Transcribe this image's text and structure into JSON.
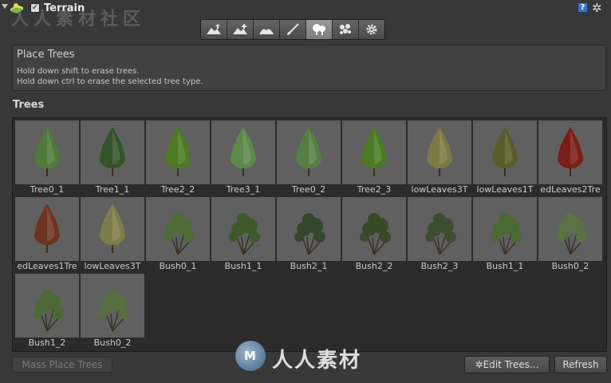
{
  "component": {
    "title": "Terrain",
    "enabled_mark": "✓",
    "help_glyph": "?",
    "menu_glyph": "✲"
  },
  "watermark_top": "人人素材社区",
  "toolbar": {
    "tools": [
      {
        "name": "raise-lower-terrain",
        "icon": "mountain-arrow-icon"
      },
      {
        "name": "paint-height",
        "icon": "mountain-plus-icon"
      },
      {
        "name": "smooth-height",
        "icon": "mountain-smooth-icon"
      },
      {
        "name": "paint-texture",
        "icon": "brush-icon"
      },
      {
        "name": "place-trees",
        "icon": "trees-icon",
        "active": true
      },
      {
        "name": "paint-details",
        "icon": "flowers-icon"
      },
      {
        "name": "terrain-settings",
        "icon": "gear-icon"
      }
    ]
  },
  "info": {
    "title": "Place Trees",
    "line1": "Hold down shift to erase trees.",
    "line2": "Hold down ctrl to erase the selected tree type."
  },
  "trees_section": {
    "label": "Trees"
  },
  "trees": [
    {
      "label": "Tree0_1",
      "kind": "conifer",
      "color": "#4f7a3a"
    },
    {
      "label": "Tree1_1",
      "kind": "conifer",
      "color": "#34532a"
    },
    {
      "label": "Tree2_2",
      "kind": "conifer",
      "color": "#4d7a22"
    },
    {
      "label": "Tree3_1",
      "kind": "conifer",
      "color": "#5c8a4a"
    },
    {
      "label": "Tree0_2",
      "kind": "conifer",
      "color": "#557f42"
    },
    {
      "label": "Tree2_3",
      "kind": "conifer",
      "color": "#4b7a24"
    },
    {
      "label": "lowLeaves3T",
      "kind": "conifer",
      "color": "#7b7a44"
    },
    {
      "label": "lowLeaves1T",
      "kind": "conifer",
      "color": "#5a5a2a"
    },
    {
      "label": "edLeaves2Tre",
      "kind": "conifer",
      "color": "#7a1e16"
    },
    {
      "label": "edLeaves1Tre",
      "kind": "conifer",
      "color": "#6e3420"
    },
    {
      "label": "lowLeaves3T",
      "kind": "conifer",
      "color": "#7f7c4a"
    },
    {
      "label": "Bush0_1",
      "kind": "bush",
      "color": "#4f6b36"
    },
    {
      "label": "Bush1_1",
      "kind": "bush",
      "color": "#3f5a2a"
    },
    {
      "label": "Bush2_1",
      "kind": "bush",
      "color": "#33472a"
    },
    {
      "label": "Bush2_2",
      "kind": "bush",
      "color": "#364a26"
    },
    {
      "label": "Bush2_3",
      "kind": "bush",
      "color": "#3b4f2e"
    },
    {
      "label": "Bush1_1",
      "kind": "bush",
      "color": "#4a6a32"
    },
    {
      "label": "Bush0_2",
      "kind": "bush",
      "color": "#5a7244"
    },
    {
      "label": "Bush1_2",
      "kind": "bush",
      "color": "#4c6a36"
    },
    {
      "label": "Bush0_2",
      "kind": "bush",
      "color": "#566e40"
    }
  ],
  "buttons": {
    "mass_place": "Mass Place Trees",
    "edit_trees": "✲Edit Trees...",
    "refresh": "Refresh"
  },
  "watermark_bottom": "人人素材"
}
